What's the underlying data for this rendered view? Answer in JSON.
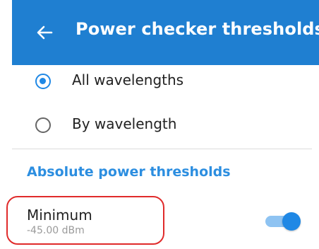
{
  "appbar": {
    "title": "Power checker thresholds",
    "back_icon": "arrow-left-icon",
    "background": "#1f7fd1"
  },
  "options": [
    {
      "label": "All wavelengths",
      "selected": true
    },
    {
      "label": "By wavelength",
      "selected": false
    }
  ],
  "section": {
    "header": "Absolute power thresholds"
  },
  "minimum": {
    "title": "Minimum",
    "value": "-45.00 dBm",
    "toggle_on": true
  },
  "colors": {
    "accent": "#1f88e5",
    "highlight": "#e02b2b"
  }
}
